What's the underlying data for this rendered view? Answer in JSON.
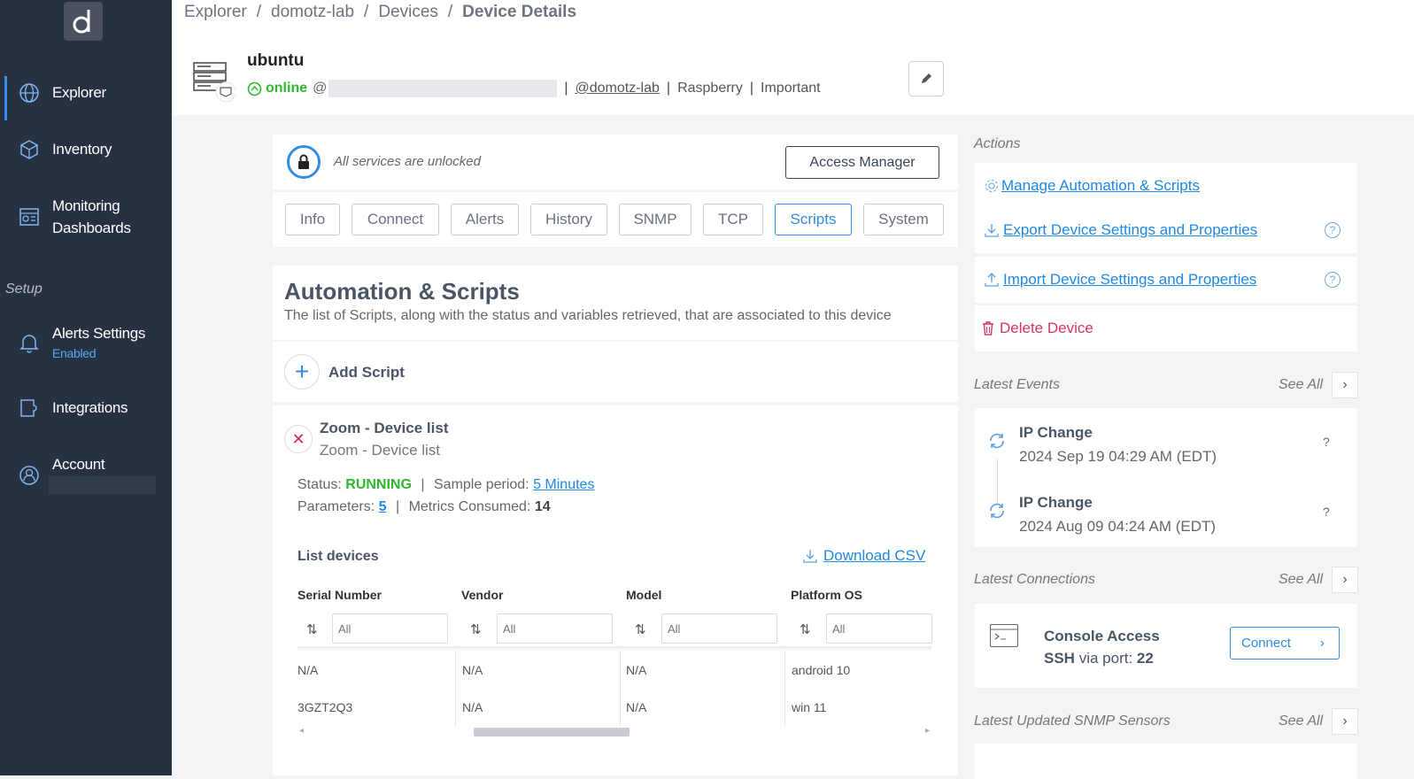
{
  "sidebar": {
    "logo_letter": "d",
    "items": [
      {
        "label": "Explorer",
        "icon": "globe-icon"
      },
      {
        "label": "Inventory",
        "icon": "cube-icon"
      },
      {
        "label": "Monitoring",
        "label2": "Dashboards",
        "icon": "dashboard-icon"
      },
      {
        "label": "Alerts Settings",
        "sub": "Enabled",
        "icon": "bell-icon"
      },
      {
        "label": "Integrations",
        "icon": "puzzle-icon"
      },
      {
        "label": "Account",
        "icon": "user-icon"
      }
    ],
    "setup_label": "Setup",
    "colors": {
      "bg": "#283142",
      "accent": "#3b8fe8"
    }
  },
  "breadcrumb": [
    "Explorer",
    "domotz-lab",
    "Devices",
    "Device Details"
  ],
  "device": {
    "name": "ubuntu",
    "status": "online",
    "at": "@",
    "collector": "@domotz-lab",
    "vendor": "Raspberry",
    "importance": "Important"
  },
  "lock": {
    "text": "All services are unlocked",
    "button": "Access Manager"
  },
  "tabs": [
    "Info",
    "Connect",
    "Alerts",
    "History",
    "SNMP",
    "TCP",
    "Scripts",
    "System"
  ],
  "selected_tab": "Scripts",
  "automation": {
    "title": "Automation & Scripts",
    "description": "The list of Scripts, along with the status and variables retrieved, that are associated to this device",
    "add_label": "Add Script"
  },
  "script": {
    "name": "Zoom - Device list",
    "subtitle": "Zoom - Device list",
    "status_label": "Status:",
    "status": "RUNNING",
    "sample_label": "Sample period:",
    "sample_value": "5 Minutes",
    "params_label": "Parameters:",
    "params_value": "5",
    "metrics_label": "Metrics Consumed:",
    "metrics_value": "14",
    "list_title": "List devices",
    "download": "Download CSV",
    "columns": [
      "Serial Number",
      "Vendor",
      "Model",
      "Platform OS"
    ],
    "filter_placeholder": "All",
    "rows": [
      [
        "N/A",
        "N/A",
        "N/A",
        "android 10"
      ],
      [
        "3GZT2Q3",
        "N/A",
        "N/A",
        "win 11"
      ]
    ]
  },
  "actions": {
    "title": "Actions",
    "items": [
      {
        "label": "Manage Automation & Scripts",
        "icon": "gear-icon",
        "help": false
      },
      {
        "label": "Export Device Settings and Properties",
        "icon": "download-icon",
        "help": true
      },
      {
        "label": "Import Device Settings and Properties",
        "icon": "upload-icon",
        "help": true
      },
      {
        "label": "Delete Device",
        "icon": "trash-icon",
        "help": false
      }
    ],
    "help_glyph": "?"
  },
  "events": {
    "title": "Latest Events",
    "see_all": "See All",
    "items": [
      {
        "title": "IP Change",
        "date": "2024 Sep 19 04:29 AM (EDT)",
        "q": "?"
      },
      {
        "title": "IP Change",
        "date": "2024 Aug 09 04:24 AM (EDT)",
        "q": "?"
      }
    ]
  },
  "connections": {
    "title": "Latest Connections",
    "see_all": "See All",
    "console_title": "Console Access",
    "proto": "SSH",
    "port_label": "via port:",
    "port": "22",
    "connect": "Connect"
  },
  "snmp": {
    "title": "Latest Updated SNMP Sensors",
    "see_all": "See All"
  }
}
